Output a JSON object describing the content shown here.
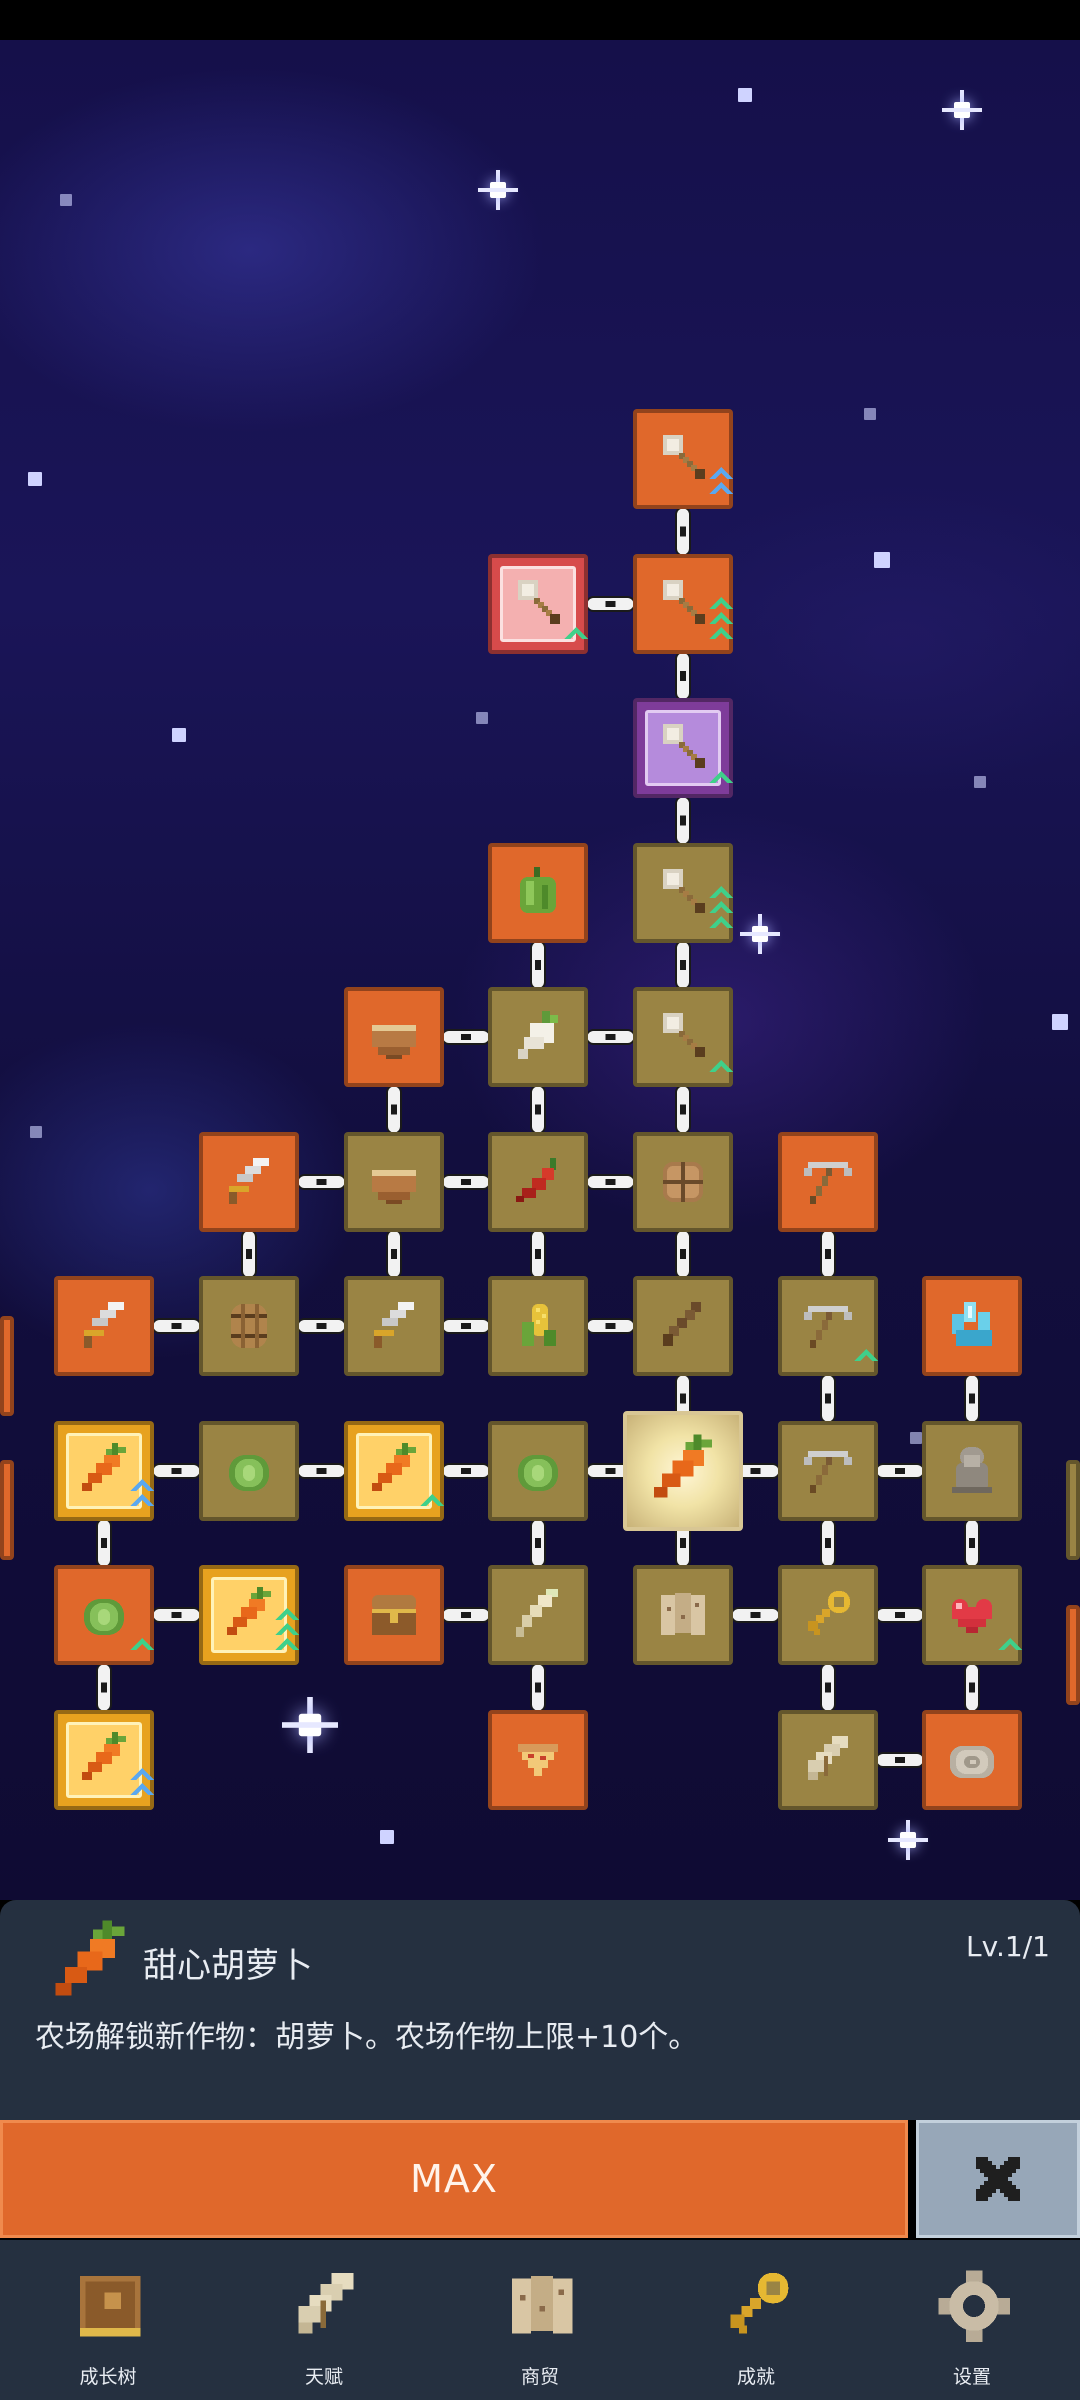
{
  "skill_tree": {
    "nodes": [
      {
        "id": "n1",
        "icon": "shovel-icon",
        "frame": "orange",
        "badge": "double-arrow"
      },
      {
        "id": "n2",
        "icon": "shovel-icon",
        "frame": "pink",
        "badge": "arrow"
      },
      {
        "id": "n3",
        "icon": "shovel-icon",
        "frame": "orange",
        "badge": "triple-arrow"
      },
      {
        "id": "n4",
        "icon": "shovel-icon",
        "frame": "purple",
        "badge": "arrow"
      },
      {
        "id": "n5",
        "icon": "bell-pepper-icon",
        "frame": "orange"
      },
      {
        "id": "n6",
        "icon": "shovel-icon",
        "frame": "tan",
        "badge": "triple-arrow"
      },
      {
        "id": "n7",
        "icon": "bowl-icon",
        "frame": "orange"
      },
      {
        "id": "n8",
        "icon": "radish-icon",
        "frame": "tan"
      },
      {
        "id": "n9",
        "icon": "shovel-icon",
        "frame": "tan",
        "badge": "arrow"
      },
      {
        "id": "n10",
        "icon": "sword-icon",
        "frame": "orange"
      },
      {
        "id": "n11",
        "icon": "bowl-icon",
        "frame": "tan"
      },
      {
        "id": "n12",
        "icon": "chili-icon",
        "frame": "tan"
      },
      {
        "id": "n13",
        "icon": "chest-icon",
        "frame": "tan"
      },
      {
        "id": "n14",
        "icon": "pickaxe-icon",
        "frame": "orange"
      },
      {
        "id": "n15",
        "icon": "sword-icon",
        "frame": "orange"
      },
      {
        "id": "n16",
        "icon": "barrel-icon",
        "frame": "tan"
      },
      {
        "id": "n17",
        "icon": "sword-icon",
        "frame": "tan"
      },
      {
        "id": "n18",
        "icon": "corn-icon",
        "frame": "tan"
      },
      {
        "id": "n19",
        "icon": "stick-icon",
        "frame": "tan"
      },
      {
        "id": "n20",
        "icon": "pickaxe-icon",
        "frame": "tan",
        "badge": "arrow"
      },
      {
        "id": "n21",
        "icon": "crystal-icon",
        "frame": "orange"
      },
      {
        "id": "n22",
        "icon": "carrot-icon",
        "frame": "gold",
        "badge": "double-arrow"
      },
      {
        "id": "n23",
        "icon": "cabbage-icon",
        "frame": "tan"
      },
      {
        "id": "n24",
        "icon": "carrot-icon",
        "frame": "gold",
        "badge": "arrow"
      },
      {
        "id": "n25",
        "icon": "cabbage-icon",
        "frame": "tan"
      },
      {
        "id": "n26",
        "icon": "carrot-icon",
        "frame": "selected"
      },
      {
        "id": "n27",
        "icon": "pickaxe-icon",
        "frame": "tan"
      },
      {
        "id": "n28",
        "icon": "statue-icon",
        "frame": "tan"
      },
      {
        "id": "n29",
        "icon": "cabbage-icon",
        "frame": "orange",
        "badge": "arrow"
      },
      {
        "id": "n30",
        "icon": "carrot-icon",
        "frame": "gold",
        "badge": "triple-arrow"
      },
      {
        "id": "n31",
        "icon": "treasure-chest-icon",
        "frame": "orange"
      },
      {
        "id": "n32",
        "icon": "parsnip-icon",
        "frame": "tan"
      },
      {
        "id": "n33",
        "icon": "map-icon",
        "frame": "tan"
      },
      {
        "id": "n34",
        "icon": "key-icon",
        "frame": "tan"
      },
      {
        "id": "n35",
        "icon": "heart-icon",
        "frame": "tan",
        "badge": "arrow"
      },
      {
        "id": "n36",
        "icon": "carrot-icon",
        "frame": "gold",
        "badge": "double-arrow"
      },
      {
        "id": "n37",
        "icon": "pizza-icon",
        "frame": "orange"
      },
      {
        "id": "n38",
        "icon": "scroll-icon",
        "frame": "tan"
      },
      {
        "id": "n39",
        "icon": "fossil-icon",
        "frame": "orange"
      }
    ]
  },
  "detail": {
    "icon": "carrot-icon",
    "title": "甜心胡萝卜",
    "level": "Lv.1/1",
    "description": "农场解锁新作物：胡萝卜。农场作物上限+10个。"
  },
  "actions": {
    "max_label": "MAX",
    "close_icon": "close-icon"
  },
  "colors": {
    "accent": "#e0682b",
    "panel": "#253040",
    "close": "#97a7b8",
    "sky": "#15104a"
  },
  "tabs": [
    {
      "label": "成长树",
      "icon": "book-icon"
    },
    {
      "label": "天赋",
      "icon": "scroll-icon"
    },
    {
      "label": "商贸",
      "icon": "map-icon"
    },
    {
      "label": "成就",
      "icon": "key-icon"
    },
    {
      "label": "设置",
      "icon": "gear-icon"
    }
  ]
}
